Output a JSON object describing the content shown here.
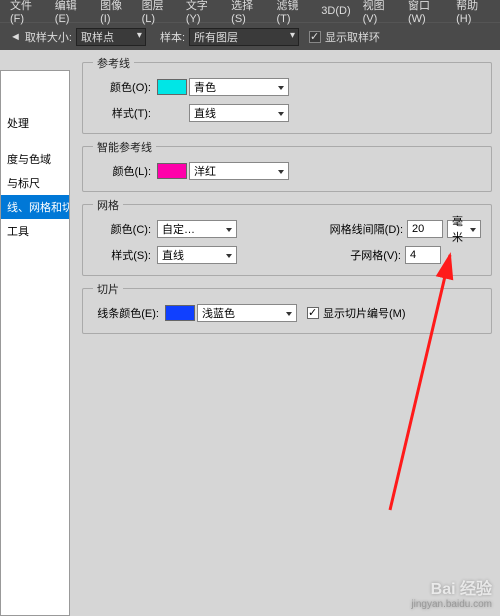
{
  "menu": {
    "file": "文件(F)",
    "edit": "编辑(E)",
    "image": "图像(I)",
    "layer": "图层(L)",
    "text": "文字(Y)",
    "select": "选择(S)",
    "filter": "滤镜(T)",
    "threeD": "3D(D)",
    "view": "视图(V)",
    "window": "窗口(W)",
    "help": "帮助(H)"
  },
  "toolbar": {
    "sampleSizeLabel": "取样大小:",
    "sampleSizeValue": "取样点",
    "sampleLabel": "样本:",
    "sampleValue": "所有图层",
    "showRingLabel": "显示取样环"
  },
  "sidebar": {
    "items": [
      "处理",
      "",
      "度与色域",
      "与标尺",
      "线、网格和切片",
      "工具"
    ],
    "selectedIndex": 4
  },
  "groups": {
    "guides": {
      "title": "参考线",
      "colorLabel": "颜色(O):",
      "colorValue": "青色",
      "colorSwatch": "#00e6e6",
      "styleLabel": "样式(T):",
      "styleValue": "直线"
    },
    "smartGuides": {
      "title": "智能参考线",
      "colorLabel": "颜色(L):",
      "colorValue": "洋红",
      "colorSwatch": "#ff00aa"
    },
    "grid": {
      "title": "网格",
      "colorLabel": "颜色(C):",
      "colorValue": "自定…",
      "styleLabel": "样式(S):",
      "styleValue": "直线",
      "spacingLabel": "网格线间隔(D):",
      "spacingValue": "20",
      "unitValue": "毫米",
      "subdivLabel": "子网格(V):",
      "subdivValue": "4"
    },
    "slice": {
      "title": "切片",
      "colorLabel": "线条颜色(E):",
      "colorValue": "浅蓝色",
      "colorSwatch": "#1040ff",
      "showNumLabel": "显示切片编号(M)"
    }
  },
  "watermark": {
    "brand": "Bai 经验",
    "url": "jingyan.baidu.com"
  }
}
